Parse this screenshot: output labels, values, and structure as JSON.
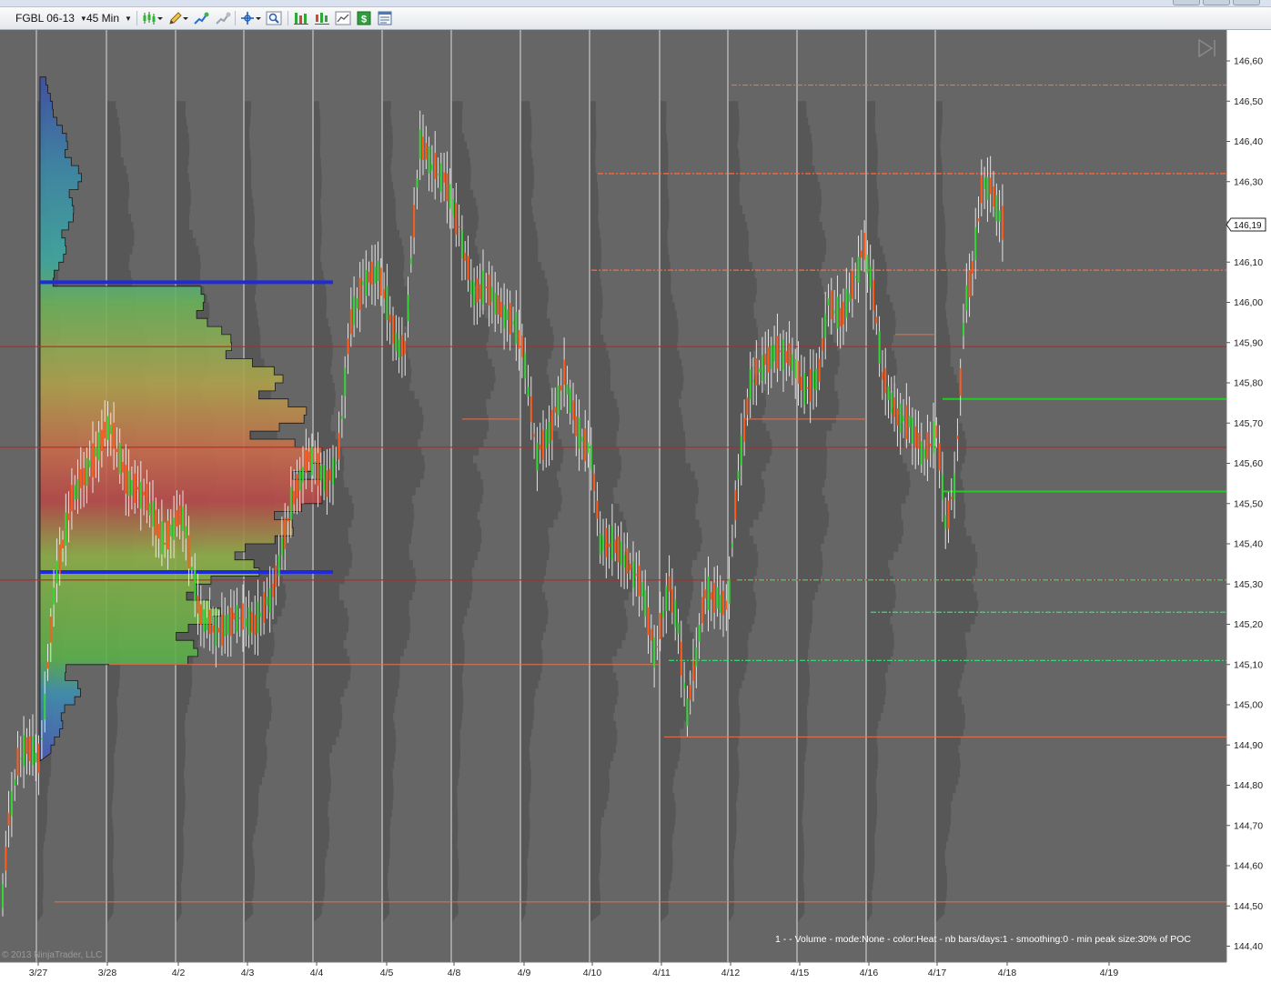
{
  "toolbar": {
    "instrument": "FGBL 06-13",
    "interval": "45 Min",
    "icons": [
      "bar-type-icon",
      "pencil-draw-icon",
      "add-indicator-icon",
      "remove-indicator-icon",
      "crosshair-icon",
      "zoom-icon",
      "properties-icon",
      "strategies-icon",
      "chart-data-icon",
      "dollar-icon",
      "data-box-icon"
    ]
  },
  "chart_data": {
    "type": "candlestick",
    "price_axis_ticks": [
      "146,60",
      "146,50",
      "146,40",
      "146,30",
      "146,20",
      "146,10",
      "146,00",
      "145,90",
      "145,80",
      "145,70",
      "145,60",
      "145,50",
      "145,40",
      "145,30",
      "145,20",
      "145,10",
      "145,00",
      "144,90",
      "144,80",
      "144,70",
      "144,60",
      "144,50",
      "144,40"
    ],
    "ylim": [
      144.35,
      146.66
    ],
    "date_labels": [
      "3/27",
      "3/28",
      "4/2",
      "4/3",
      "4/4",
      "4/5",
      "4/8",
      "4/9",
      "4/10",
      "4/11",
      "4/12",
      "4/15",
      "4/16",
      "4/17",
      "4/18",
      "4/19"
    ],
    "last_price": "146,19",
    "last_price_value": 146.19,
    "indicator_text": "1 -  - Volume - mode:None - color:Heat - nb bars/days:1 - smoothing:0 - min peak size:30% of POC",
    "copyright": "© 2013 NinjaTrader, LLC",
    "colors": {
      "background": "#666666",
      "up_candle": "#37d637",
      "down_candle": "#ff5c1c",
      "wick": "#f2f2f2",
      "poc_line": "#cc1f1f",
      "value_area_line": "#1f2bd9",
      "resistance_dotted": "#ff6a3d",
      "support_dotted": "#35e27a"
    },
    "horizontal_levels": [
      {
        "price": 146.54,
        "style": "dotted",
        "color": "#ff6a3d"
      },
      {
        "price": 146.32,
        "style": "dotted",
        "color": "#ff6a3d"
      },
      {
        "price": 146.08,
        "style": "dotted",
        "color": "#ff6a3d"
      },
      {
        "price": 145.89,
        "style": "solid",
        "color": "#cc1f1f"
      },
      {
        "price": 145.64,
        "style": "solid",
        "color": "#cc1f1f"
      },
      {
        "price": 145.31,
        "style": "solid",
        "color": "#cc1f1f"
      },
      {
        "price": 145.76,
        "style": "solid",
        "color": "#22cc22"
      },
      {
        "price": 145.53,
        "style": "solid",
        "color": "#22cc22"
      },
      {
        "price": 145.31,
        "style": "dotted",
        "color": "#35e27a"
      },
      {
        "price": 145.23,
        "style": "dotted",
        "color": "#35e27a"
      },
      {
        "price": 145.11,
        "style": "dotted",
        "color": "#35e27a"
      },
      {
        "price": 146.05,
        "style": "solid",
        "color": "#1f2bd9"
      },
      {
        "price": 145.33,
        "style": "solid",
        "color": "#1f2bd9"
      }
    ],
    "profile_poc": 145.52,
    "profile_value_area": [
      145.33,
      146.05
    ]
  }
}
